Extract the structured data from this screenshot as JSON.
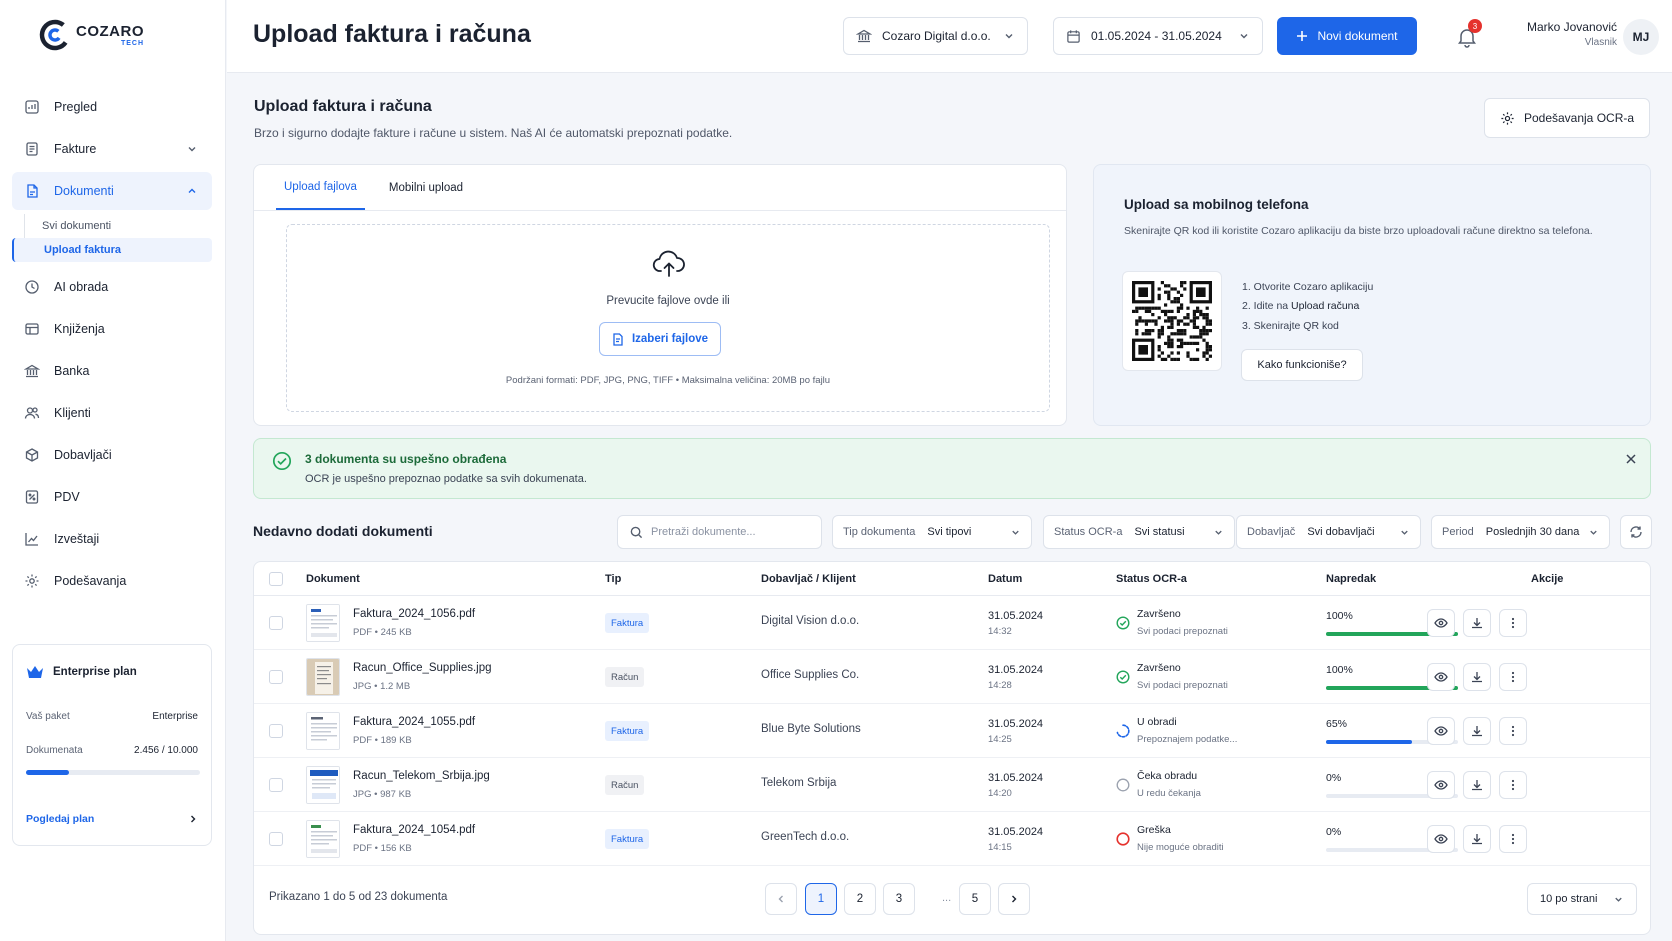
{
  "brand": {
    "name": "COZARO",
    "sub": "TECH",
    "accent": "#1e66e8"
  },
  "sidebar": {
    "items": [
      {
        "label": "Pregled"
      },
      {
        "label": "Fakture"
      },
      {
        "label": "Dokumenti"
      },
      {
        "label": "AI obrada"
      },
      {
        "label": "Knjiženja"
      },
      {
        "label": "Banka"
      },
      {
        "label": "Klijenti"
      },
      {
        "label": "Dobavljači"
      },
      {
        "label": "PDV"
      },
      {
        "label": "Izveštaji"
      },
      {
        "label": "Podešavanja"
      }
    ],
    "subitems": [
      {
        "label": "Svi dokumenti"
      },
      {
        "label": "Upload faktura"
      }
    ],
    "plan": {
      "title": "Enterprise plan",
      "package_label": "Vaš paket",
      "package_value": "Enterprise",
      "docs_label": "Dokumenata",
      "docs_value": "2.456 / 10.000",
      "usage_fraction": 0.2456,
      "link": "Pogledaj plan"
    }
  },
  "header": {
    "title": "Upload faktura i računa",
    "company": "Cozaro Digital d.o.o.",
    "date_range": "01.05.2024 - 31.05.2024",
    "new_doc": "Novi dokument",
    "notifications": "3",
    "user_name": "Marko Jovanović",
    "user_role": "Vlasnik",
    "initials": "MJ"
  },
  "section": {
    "title": "Upload faktura i računa",
    "subtitle": "Brzo i sigurno dodajte fakture i račune u sistem. Naš AI će automatski prepoznati podatke.",
    "ocr_settings": "Podešavanja OCR-a"
  },
  "upload": {
    "tab1": "Upload fajlova",
    "tab2": "Mobilni upload",
    "drop_text": "Prevucite fajlove ovde ili",
    "choose": "Izaberi fajlove",
    "footer": "Podržani formati: PDF, JPG, PNG, TIFF  •  Maksimalna veličina: 20MB po fajlu"
  },
  "mobile": {
    "title": "Upload sa mobilnog telefona",
    "desc": "Skenirajte QR kod ili koristite Cozaro aplikaciju da biste brzo uploadovali račune direktno sa telefona.",
    "step1": "1. Otvorite Cozaro aplikaciju",
    "step2_pre": "2. Idite na ",
    "step2_bold": "Upload računa",
    "step3": "3. Skenirajte QR kod",
    "how": "Kako funkcioniše?"
  },
  "success": {
    "title": "3 dokumenta su uspešno obrađena",
    "subtitle": "OCR je uspešno prepoznao podatke sa svih dokumenata."
  },
  "list": {
    "title": "Nedavno dodati dokumenti",
    "search_placeholder": "Pretraži dokumente...",
    "filters": [
      {
        "label": "Tip dokumenta",
        "value": "Svi tipovi"
      },
      {
        "label": "Status OCR-a",
        "value": "Svi statusi"
      },
      {
        "label": "Dobavljač",
        "value": "Svi dobavljači"
      },
      {
        "label": "Period",
        "value": "Poslednjih 30 dana"
      }
    ],
    "columns": [
      "Dokument",
      "Tip",
      "Dobavljač / Klijent",
      "Datum",
      "Status OCR-a",
      "Napredak",
      "Akcije"
    ],
    "rows": [
      {
        "name": "Faktura_2024_1056.pdf",
        "meta": "PDF  •  245 KB",
        "type": "Faktura",
        "supplier": "Digital Vision d.o.o.",
        "date": "31.05.2024",
        "time": "14:32",
        "status": "Završeno",
        "status_sub": "Svi podaci prepoznati",
        "progress": "100%",
        "progress_value": 1.0
      },
      {
        "name": "Racun_Office_Supplies.jpg",
        "meta": "JPG  •  1.2 MB",
        "type": "Račun",
        "supplier": "Office Supplies Co.",
        "date": "31.05.2024",
        "time": "14:28",
        "status": "Završeno",
        "status_sub": "Svi podaci prepoznati",
        "progress": "100%",
        "progress_value": 1.0
      },
      {
        "name": "Faktura_2024_1055.pdf",
        "meta": "PDF  •  189 KB",
        "type": "Faktura",
        "supplier": "Blue Byte Solutions",
        "date": "31.05.2024",
        "time": "14:25",
        "status": "U obradi",
        "status_sub": "Prepoznajem podatke...",
        "progress": "65%",
        "progress_value": 0.65
      },
      {
        "name": "Racun_Telekom_Srbija.jpg",
        "meta": "JPG  •  987 KB",
        "type": "Račun",
        "supplier": "Telekom Srbija",
        "date": "31.05.2024",
        "time": "14:20",
        "status": "Čeka obradu",
        "status_sub": "U redu čekanja",
        "progress": "0%",
        "progress_value": 0
      },
      {
        "name": "Faktura_2024_1054.pdf",
        "meta": "PDF  •  156 KB",
        "type": "Faktura",
        "supplier": "GreenTech d.o.o.",
        "date": "31.05.2024",
        "time": "14:15",
        "status": "Greška",
        "status_sub": "Nije moguće obraditi",
        "progress": "0%",
        "progress_value": 0
      }
    ],
    "footer": "Prikazano 1 do 5 od 23 dokumenta",
    "pages": [
      "1",
      "2",
      "3",
      "5"
    ],
    "ellipsis": "...",
    "per_page": "10 po strani"
  },
  "colors": {
    "success": "#22a55a",
    "progress": "#1e66e8",
    "error": "#e5322d",
    "pending": "#9aa1ae"
  }
}
